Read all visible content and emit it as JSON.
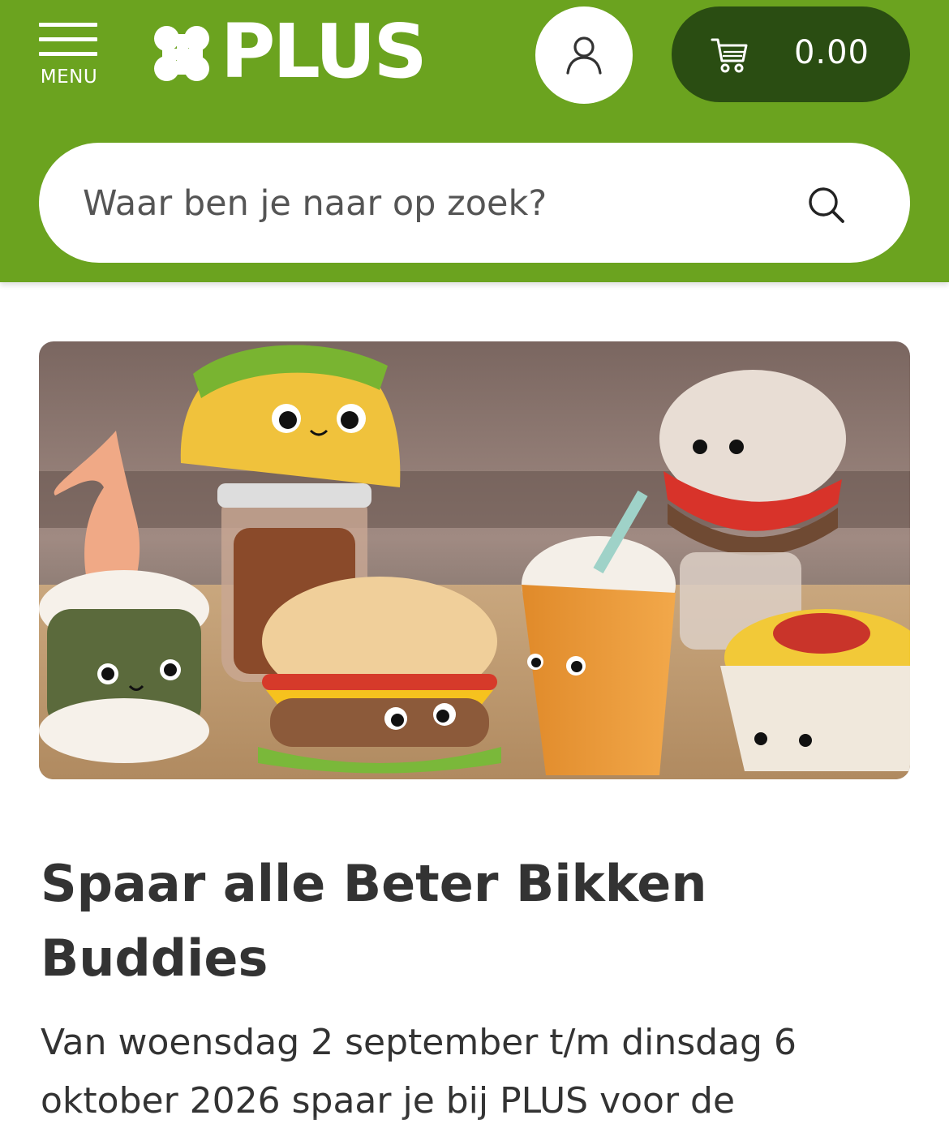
{
  "header": {
    "menu_label": "MENU",
    "logo_text": "PLUS",
    "cart_total": "0.00",
    "brand_color": "#6ba31f",
    "cart_color": "#2a4d12"
  },
  "search": {
    "placeholder": "Waar ben je naar op zoek?",
    "icon": "search-icon"
  },
  "article": {
    "hero_image": "plush food toys: taco, sushi roll, hamburger, drink cup, pita sandwich, pasta bowl",
    "title": "Spaar alle Beter Bikken Buddies",
    "intro": "Van woensdag 2 september t/m dinsdag 6 oktober 2026 spaar je bij PLUS voor de"
  }
}
